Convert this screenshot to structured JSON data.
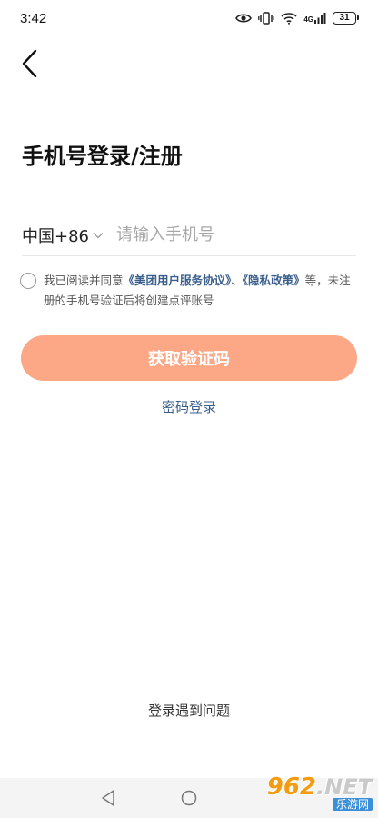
{
  "status_bar": {
    "time": "3:42",
    "network": "4G",
    "battery": "31"
  },
  "page": {
    "title": "手机号登录/注册"
  },
  "phone": {
    "country_code": "中国+86",
    "placeholder": "请输入手机号",
    "value": ""
  },
  "agreement": {
    "prefix": "我已阅读并同意",
    "link1": "《美团用户服务协议》",
    "separator": "、",
    "link2": "《隐私政策》",
    "suffix": "等，未注册的手机号验证后将创建点评账号",
    "checked": false
  },
  "actions": {
    "get_code": "获取验证码",
    "password_login": "密码登录",
    "help": "登录遇到问题"
  },
  "colors": {
    "primary": "#fca887",
    "link": "#3a5f8c"
  },
  "watermark": {
    "main": "962",
    "net": ".NET",
    "sub": "乐游网"
  }
}
